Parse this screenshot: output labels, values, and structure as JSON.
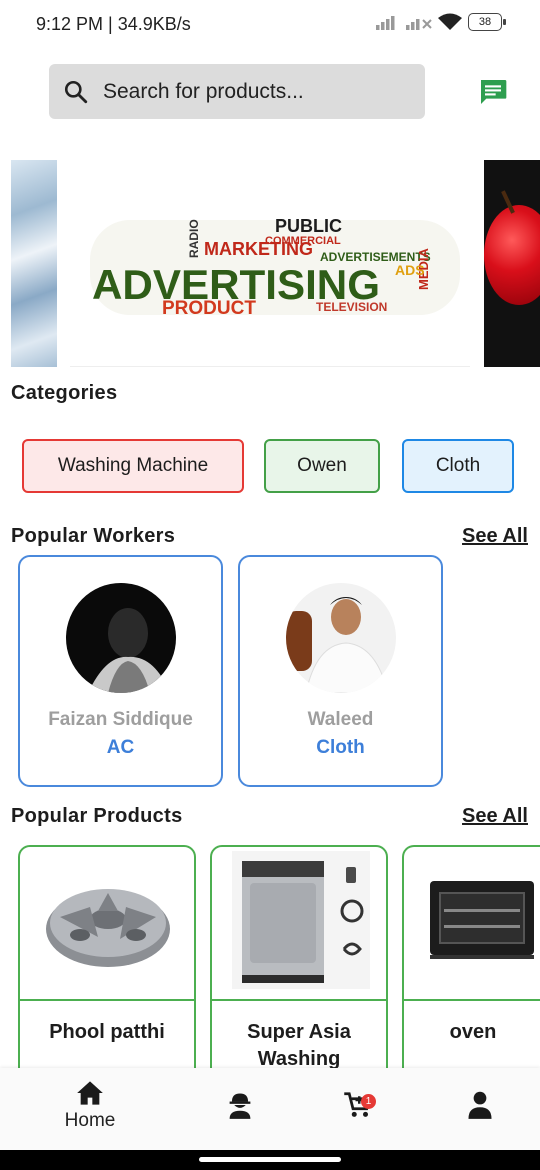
{
  "status_bar": {
    "time_speed": "9:12 PM | 34.9KB/s",
    "battery": "38"
  },
  "search": {
    "placeholder": "Search for products..."
  },
  "banner": {
    "words": [
      "ADVERTISING",
      "MARKETING",
      "PUBLIC",
      "PRODUCT",
      "TELEVISION",
      "COMMERCIAL",
      "ADVERTISEMENTS",
      "RADIO",
      "MEDIA",
      "ADS"
    ]
  },
  "categories": {
    "title": "Categories",
    "items": [
      {
        "label": "Washing Machine",
        "color": "#e53935",
        "bg": "#fde8e8"
      },
      {
        "label": "Owen",
        "color": "#43a047",
        "bg": "#e8f5e9"
      },
      {
        "label": "Cloth",
        "color": "#1e88e5",
        "bg": "#e3f2fd"
      }
    ]
  },
  "popular_workers": {
    "title": "Popular Workers",
    "see_all": "See All",
    "items": [
      {
        "name": "Faizan Siddique",
        "category": "AC"
      },
      {
        "name": "Waleed",
        "category": "Cloth"
      }
    ]
  },
  "popular_products": {
    "title": "Popular Products",
    "see_all": "See All",
    "items": [
      {
        "name": "Phool patthi"
      },
      {
        "name": "Super Asia Washing"
      },
      {
        "name": "oven"
      }
    ]
  },
  "bottom_nav": {
    "home_label": "Home",
    "cart_count": "1"
  },
  "colors": {
    "worker_border": "#4a89dc",
    "product_border": "#4caf50",
    "chat_icon": "#2e9e4f",
    "cart_badge": "#e53935"
  }
}
